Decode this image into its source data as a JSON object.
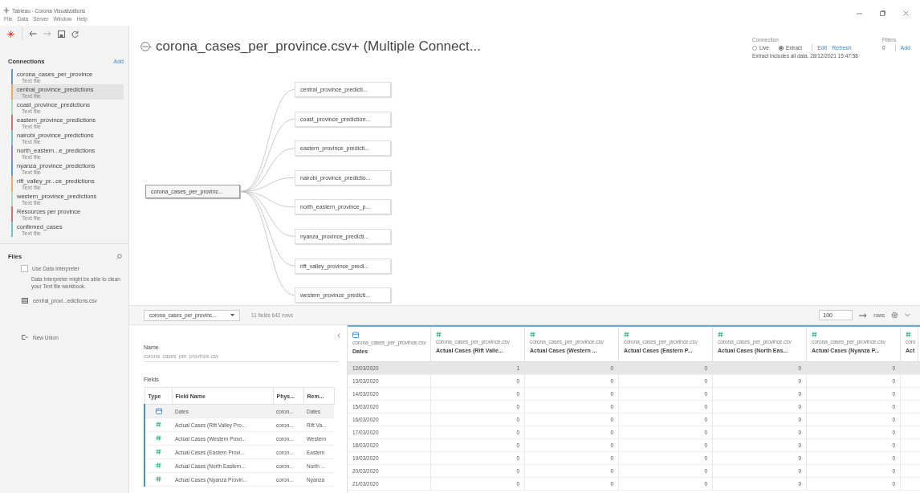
{
  "window": {
    "title": "Tableau - Corona Visualizations"
  },
  "menu": [
    "File",
    "Data",
    "Server",
    "Window",
    "Help"
  ],
  "connections": {
    "header": "Connections",
    "add": "Add",
    "items": [
      {
        "name": "corona_cases_per_province",
        "type": "Text file",
        "color": "#5b9ccf",
        "selected": false
      },
      {
        "name": "central_province_predictions",
        "type": "Text file",
        "color": "#f4a65a",
        "selected": true
      },
      {
        "name": "coast_province_predictions",
        "type": "Text file",
        "color": "#a8dcc0",
        "selected": false
      },
      {
        "name": "eastern_province_predictions",
        "type": "Text file",
        "color": "#e06b6b",
        "selected": false
      },
      {
        "name": "nairobi_province_predictions",
        "type": "Text file",
        "color": "#73c0cf",
        "selected": false
      },
      {
        "name": "north_eastern...e_predictions",
        "type": "Text file",
        "color": "#9a80c6",
        "selected": false
      },
      {
        "name": "nyanza_province_predictions",
        "type": "Text file",
        "color": "#5b9ccf",
        "selected": false
      },
      {
        "name": "rift_valley_pr...ce_predictions",
        "type": "Text file",
        "color": "#f4a65a",
        "selected": false
      },
      {
        "name": "western_province_predictions",
        "type": "Text file",
        "color": "#a8dcc0",
        "selected": false
      },
      {
        "name": "Resources per province",
        "type": "Text file",
        "color": "#e06b6b",
        "selected": false
      },
      {
        "name": "confirmed_cases",
        "type": "Text file",
        "color": "#73c0cf",
        "selected": false
      }
    ]
  },
  "files": {
    "header": "Files",
    "interpreter": {
      "label": "Use Data Interpreter",
      "checked": false,
      "note": "Data Interpreter might be able to clean your Text file workbook."
    },
    "items": [
      "central_provi...edictions.csv"
    ],
    "new_union": "New Union"
  },
  "data_source": {
    "title": "corona_cases_per_province.csv+ (Multiple Connect...",
    "connection_label": "Connection",
    "modes": [
      {
        "label": "Live",
        "selected": false
      },
      {
        "label": "Extract",
        "selected": true
      }
    ],
    "edit": "Edit",
    "refresh": "Refresh",
    "extract_note": "Extract includes all data. 28/12/2021 15:47:58",
    "filters_label": "Filters",
    "filters_count": "0",
    "filters_add": "Add"
  },
  "diagram": {
    "root": "corona_cases_per_provinc...",
    "children": [
      "central_province_predicti...",
      "coast_province_prediction...",
      "eastern_province_predicti...",
      "nairobi_province_predictio...",
      "north_eastern_province_p...",
      "nyanza_province_predicti...",
      "rift_valley_province_predi...",
      "western_province_predicti..."
    ]
  },
  "grid_toolbar": {
    "table": "corona_cases_per_provinc...",
    "summary": "11 fields 642 rows",
    "row_limit": "100",
    "rows_label": "rows"
  },
  "metadata": {
    "name_label": "Name",
    "name_value": "corona_cases_per_province.csv",
    "fields_label": "Fields",
    "columns": [
      "Type",
      "Field Name",
      "Phys...",
      "Rem..."
    ],
    "rows": [
      {
        "kind": "date",
        "name": "Dates",
        "physical": "coron...",
        "remote": "Dates",
        "selected": true
      },
      {
        "kind": "number",
        "name": "Actual Cases (Rift Valley Pro...",
        "physical": "coron...",
        "remote": "Rift Va...",
        "selected": false
      },
      {
        "kind": "number",
        "name": "Actual Cases (Western Provi...",
        "physical": "coron...",
        "remote": "Western",
        "selected": false
      },
      {
        "kind": "number",
        "name": "Actual Cases (Eastern Provi...",
        "physical": "coron...",
        "remote": "Eastern",
        "selected": false
      },
      {
        "kind": "number",
        "name": "Actual Cases (North Eastern...",
        "physical": "coron...",
        "remote": "North ...",
        "selected": false
      },
      {
        "kind": "number",
        "name": "Actual Cases (Nyanza Provin...",
        "physical": "coron...",
        "remote": "Nyanza",
        "selected": false
      }
    ]
  },
  "grid": {
    "columns": [
      {
        "kind": "date",
        "source": "corona_cases_per_province.csv",
        "name": "Dates"
      },
      {
        "kind": "number",
        "source": "corona_cases_per_province.csv",
        "name": "Actual Cases (Rift Valle..."
      },
      {
        "kind": "number",
        "source": "corona_cases_per_province.csv",
        "name": "Actual Cases (Western ..."
      },
      {
        "kind": "number",
        "source": "corona_cases_per_province.csv",
        "name": "Actual Cases (Eastern P..."
      },
      {
        "kind": "number",
        "source": "corona_cases_per_province.csv",
        "name": "Actual Cases (North Eas..."
      },
      {
        "kind": "number",
        "source": "corona_cases_per_province.csv",
        "name": "Actual Cases (Nyanza P..."
      },
      {
        "kind": "number",
        "source": "coro",
        "name": "Act"
      }
    ],
    "rows": [
      {
        "selected": true,
        "cells": [
          "12/03/2020",
          "1",
          "0",
          "0",
          "0",
          "0"
        ]
      },
      {
        "selected": false,
        "cells": [
          "13/03/2020",
          "0",
          "0",
          "0",
          "0",
          "0"
        ]
      },
      {
        "selected": false,
        "cells": [
          "14/03/2020",
          "0",
          "0",
          "0",
          "0",
          "0"
        ]
      },
      {
        "selected": false,
        "cells": [
          "15/03/2020",
          "0",
          "0",
          "0",
          "0",
          "0"
        ]
      },
      {
        "selected": false,
        "cells": [
          "16/03/2020",
          "0",
          "0",
          "0",
          "0",
          "0"
        ]
      },
      {
        "selected": false,
        "cells": [
          "17/03/2020",
          "0",
          "0",
          "0",
          "0",
          "0"
        ]
      },
      {
        "selected": false,
        "cells": [
          "18/03/2020",
          "0",
          "0",
          "0",
          "0",
          "0"
        ]
      },
      {
        "selected": false,
        "cells": [
          "19/03/2020",
          "0",
          "0",
          "0",
          "0",
          "0"
        ]
      },
      {
        "selected": false,
        "cells": [
          "20/03/2020",
          "0",
          "0",
          "0",
          "0",
          "0"
        ]
      },
      {
        "selected": false,
        "cells": [
          "21/03/2020",
          "0",
          "0",
          "0",
          "0",
          "0"
        ]
      }
    ]
  }
}
